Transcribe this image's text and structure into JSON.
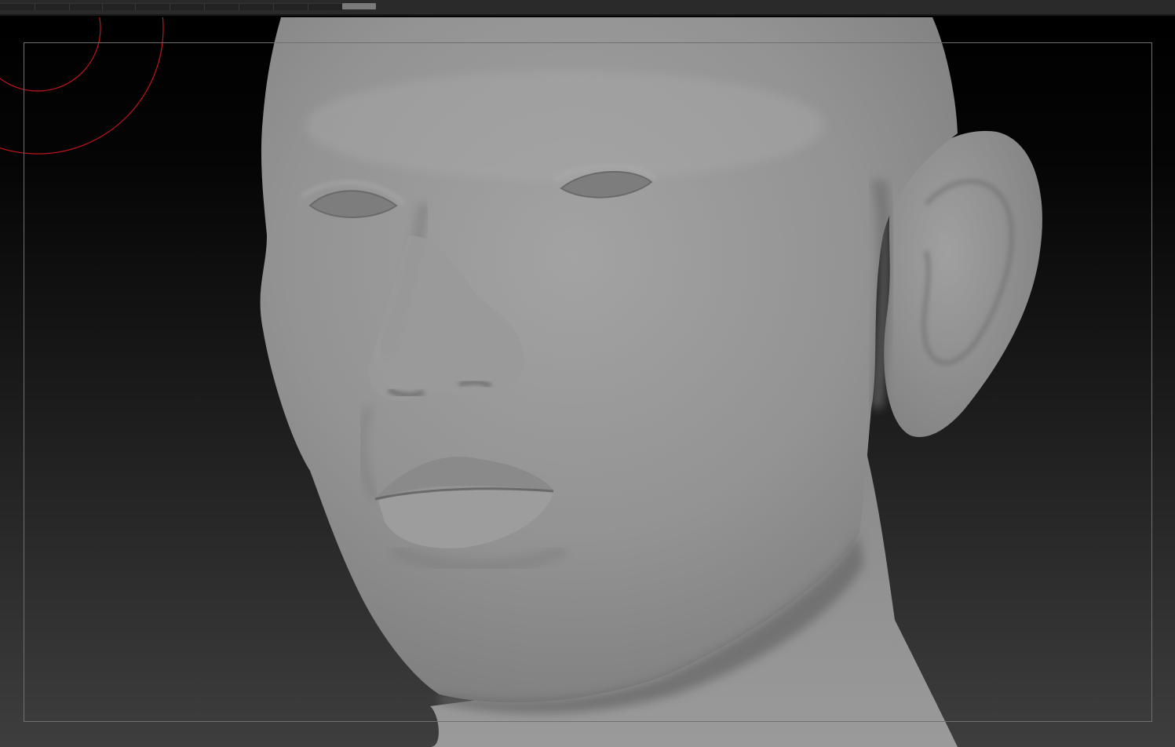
{
  "app": {
    "accent": "#c0151a",
    "background": "#000000"
  },
  "top_bar": {
    "scroll_thumb_color": "#7a7a7a"
  },
  "canvas": {
    "model": "head-sculpt",
    "material_color": "#8e8e8e",
    "brush_cursor_color": "#c0151a"
  }
}
